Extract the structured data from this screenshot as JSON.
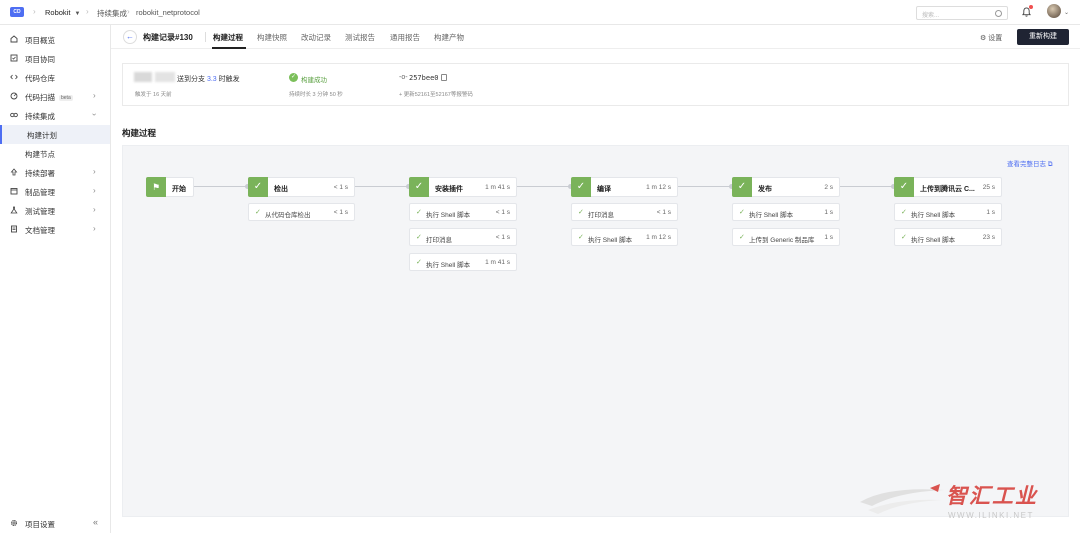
{
  "topbar": {
    "logo_text": "Robokit",
    "breadcrumbs": [
      {
        "label": "Robokit"
      },
      {
        "label": "持续集成"
      },
      {
        "label": "robokit_netprotocol"
      }
    ],
    "search_placeholder": "搜索..."
  },
  "sidebar": {
    "items": [
      {
        "label": "项目概览",
        "icon": "home-icon"
      },
      {
        "label": "项目协同",
        "icon": "board-icon"
      },
      {
        "label": "代码仓库",
        "icon": "code-icon"
      },
      {
        "label": "代码扫描",
        "icon": "scan-icon",
        "beta": "beta"
      },
      {
        "label": "持续集成",
        "icon": "ci-icon"
      },
      {
        "label": "持续部署",
        "icon": "deploy-icon"
      },
      {
        "label": "制品管理",
        "icon": "artifact-icon"
      },
      {
        "label": "测试管理",
        "icon": "test-icon"
      },
      {
        "label": "文档管理",
        "icon": "doc-icon"
      }
    ],
    "sub_items": [
      {
        "label": "构建计划"
      },
      {
        "label": "构建节点"
      }
    ],
    "footer_label": "项目设置"
  },
  "header": {
    "title": "构建记录#130",
    "tabs": [
      "构建过程",
      "构建快照",
      "改动记录",
      "测试报告",
      "通用报告",
      "构建产物"
    ],
    "settings_label": "设置",
    "rebuild_label": "重新构建"
  },
  "summary": {
    "trigger_prefix": "送到分支",
    "branch": "3.3",
    "trigger_suffix": "时触发",
    "trigger_time": "触发于 16 天前",
    "status": "构建成功",
    "duration": "持续时长 3 分钟 50 秒",
    "commit": "257bee0",
    "commit_desc": "+ 更新52161至52167等报警码"
  },
  "section_title": "构建过程",
  "pipeline": {
    "full_log_label": "查看完整日志",
    "start_label": "开始",
    "stages": [
      {
        "name": "检出",
        "time": "< 1 s",
        "steps": [
          {
            "name": "从代码仓库检出",
            "time": "< 1 s"
          }
        ]
      },
      {
        "name": "安装插件",
        "time": "1 m 41 s",
        "steps": [
          {
            "name": "执行 Shell 脚本",
            "time": "< 1 s"
          },
          {
            "name": "打印消息",
            "time": "< 1 s"
          },
          {
            "name": "执行 Shell 脚本",
            "time": "1 m 41 s"
          }
        ]
      },
      {
        "name": "编译",
        "time": "1 m 12 s",
        "steps": [
          {
            "name": "打印消息",
            "time": "< 1 s"
          },
          {
            "name": "执行 Shell 脚本",
            "time": "1 m 12 s"
          }
        ]
      },
      {
        "name": "发布",
        "time": "2 s",
        "steps": [
          {
            "name": "执行 Shell 脚本",
            "time": "1 s"
          },
          {
            "name": "上传到 Generic 制品库",
            "time": "1 s"
          }
        ]
      },
      {
        "name": "上传到腾讯云 C...",
        "time": "25 s",
        "steps": [
          {
            "name": "执行 Shell 脚本",
            "time": "1 s"
          },
          {
            "name": "执行 Shell 脚本",
            "time": "23 s"
          }
        ]
      }
    ]
  },
  "watermark": {
    "text": "智汇工业",
    "url": "WWW.ILINKI.NET"
  }
}
